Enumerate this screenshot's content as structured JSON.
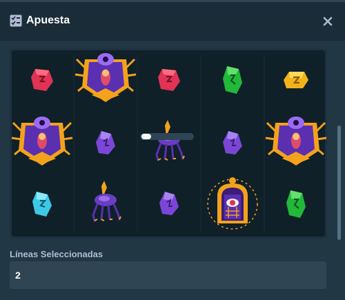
{
  "header": {
    "title": "Apuesta",
    "icon": "bet-slip-icon",
    "close_icon": "close-icon"
  },
  "reels": {
    "columns": [
      [
        "red-rune",
        "spider-oracle",
        "cyan-rune"
      ],
      [
        "spider-oracle",
        "purple-rune",
        "spider-creature"
      ],
      [
        "red-rune",
        "spider-creature",
        "purple-rune"
      ],
      [
        "green-rune",
        "purple-rune",
        "eye-portal"
      ],
      [
        "yellow-rune",
        "spider-oracle",
        "green-rune"
      ]
    ]
  },
  "lines": {
    "label": "Líneas Seleccionadas",
    "value": "2"
  },
  "colors": {
    "background": "#1a2c38",
    "panel": "#213743",
    "input": "#2f4553",
    "label": "#b1bad3"
  }
}
